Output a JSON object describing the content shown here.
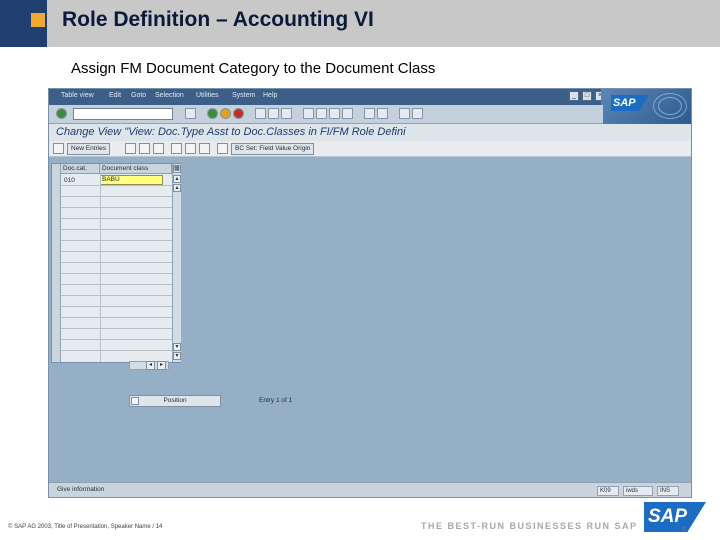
{
  "slide": {
    "title": "Role Definition – Accounting VI",
    "subtitle": "Assign FM Document Category to the Document Class",
    "footer_copyright": "© SAP AG 2003, Title of Presentation, Speaker Name / 14",
    "tagline": "THE BEST-RUN BUSINESSES RUN SAP",
    "logo_text": "SAP",
    "logo_reg": "®"
  },
  "menubar": {
    "items": [
      "Table view",
      "Edit",
      "Goto",
      "Selection",
      "Utilities",
      "System",
      "Help"
    ],
    "logo_text": "SAP"
  },
  "screen": {
    "title": "Change View \"View: Doc.Type Asst to Doc.Classes in FI/FM Role Defini"
  },
  "app_toolbar": {
    "new_entries": "New Entries",
    "bc_set": "BC Set: Field Value Origin"
  },
  "table": {
    "columns": [
      "Doc.cat.",
      "Document class"
    ],
    "rows": [
      {
        "doc_cat": "010",
        "document_class": "BABU"
      }
    ]
  },
  "position_button": "Position",
  "entry_text": "Entry 1 of 1",
  "statusbar": {
    "message": "Give information",
    "fields": [
      "K09",
      "iwds",
      "INS"
    ]
  }
}
